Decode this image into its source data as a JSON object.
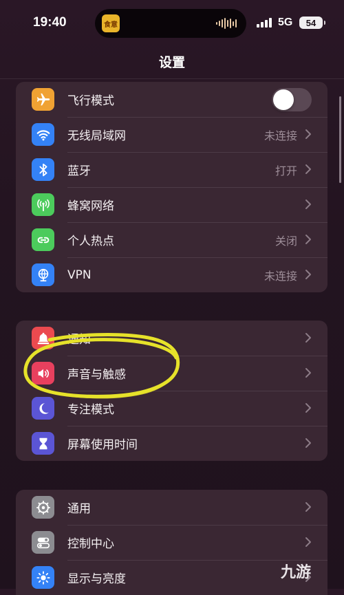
{
  "status_bar": {
    "time": "19:40",
    "island_app_icon": "食意",
    "network": "5G",
    "battery": "54"
  },
  "header": {
    "title": "设置"
  },
  "groups": [
    {
      "items": [
        {
          "label": "飞行模式",
          "icon": "airplane-icon",
          "color": "#f0a233",
          "toggle": false
        },
        {
          "label": "无线局域网",
          "icon": "wifi-icon",
          "color": "#3482f6",
          "value": "未连接"
        },
        {
          "label": "蓝牙",
          "icon": "bluetooth-icon",
          "color": "#3482f6",
          "value": "打开"
        },
        {
          "label": "蜂窝网络",
          "icon": "cellular-icon",
          "color": "#4ccb5c",
          "value": ""
        },
        {
          "label": "个人热点",
          "icon": "hotspot-icon",
          "color": "#4ccb5c",
          "value": "关闭"
        },
        {
          "label": "VPN",
          "icon": "vpn-globe-icon",
          "color": "#3482f6",
          "value": "未连接"
        }
      ]
    },
    {
      "items": [
        {
          "label": "通知",
          "icon": "bell-icon",
          "color": "#eb4a4f",
          "value": ""
        },
        {
          "label": "声音与触感",
          "icon": "speaker-icon",
          "color": "#e8405e",
          "value": ""
        },
        {
          "label": "专注模式",
          "icon": "moon-icon",
          "color": "#5b55d5",
          "value": ""
        },
        {
          "label": "屏幕使用时间",
          "icon": "hourglass-icon",
          "color": "#5b55d5",
          "value": ""
        }
      ]
    },
    {
      "items": [
        {
          "label": "通用",
          "icon": "gear-icon",
          "color": "#8c8c91",
          "value": ""
        },
        {
          "label": "控制中心",
          "icon": "toggles-icon",
          "color": "#8c8c91",
          "value": ""
        },
        {
          "label": "显示与亮度",
          "icon": "sun-icon",
          "color": "#3482f6",
          "value": ""
        }
      ]
    }
  ],
  "watermark": "九游",
  "colors": {
    "annotation": "#e6e22a"
  }
}
